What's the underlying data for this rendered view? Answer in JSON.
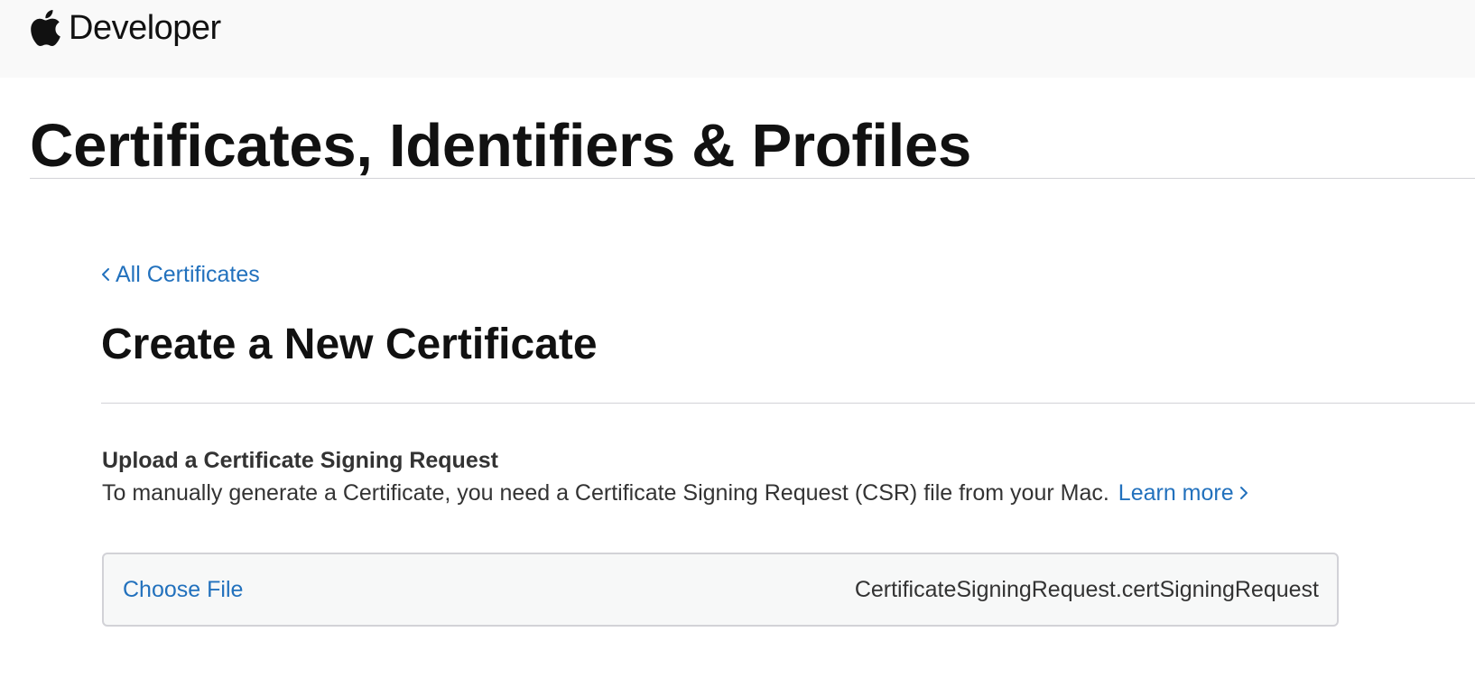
{
  "header": {
    "brand_icon": "apple-logo-icon",
    "brand_text": "Developer"
  },
  "page": {
    "title": "Certificates, Identifiers & Profiles"
  },
  "nav": {
    "back_icon": "chevron-left-icon",
    "back_label": "All Certificates"
  },
  "section": {
    "title": "Create a New Certificate",
    "upload_heading": "Upload a Certificate Signing Request",
    "upload_description": "To manually generate a Certificate, you need a Certificate Signing Request (CSR) file from your Mac.",
    "learn_more_label": "Learn more",
    "learn_more_icon": "chevron-right-icon"
  },
  "file_input": {
    "choose_label": "Choose File",
    "selected_file": "CertificateSigningRequest.certSigningRequest"
  },
  "colors": {
    "link": "#2271bd",
    "nav_background": "#f9f9f9",
    "text": "#111111",
    "secondary_text": "#333333",
    "divider": "#d2d2d7",
    "file_box_background": "#f7f8f8"
  }
}
